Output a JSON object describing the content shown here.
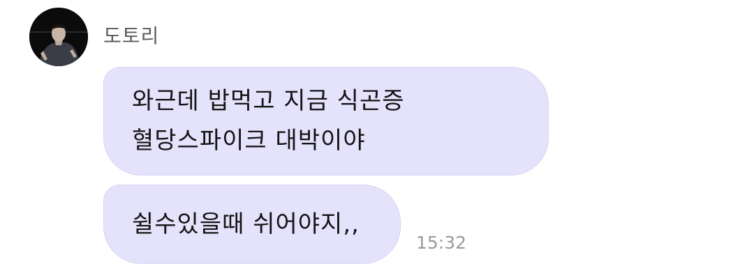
{
  "message_group": {
    "sender": {
      "name": "도토리"
    },
    "bubbles": [
      {
        "lines": [
          "와근데 밥먹고 지금 식곤증",
          "혈당스파이크 대박이야"
        ]
      },
      {
        "lines": [
          "쉴수있을때 쉬어야지,,"
        ]
      }
    ],
    "timestamp": "15:32"
  },
  "colors": {
    "bubble_background": "#e5e2fc",
    "sender_name": "#5a5a5a",
    "timestamp": "#9a9a9a",
    "message_text": "#141414"
  }
}
